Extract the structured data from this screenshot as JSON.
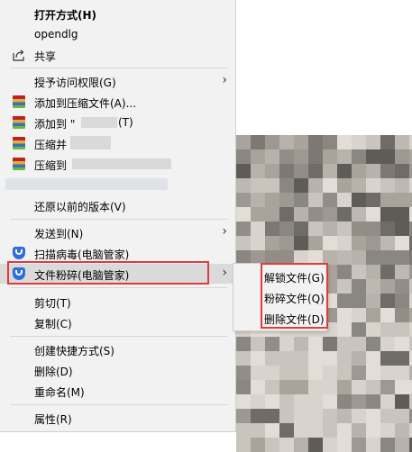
{
  "menu": {
    "open_with_bold": "打开方式(H)",
    "opendlg": "opendlg",
    "share": "共享",
    "grant_access": "授予访问权限(G)",
    "add_to_archive": "添加到压缩文件(A)...",
    "add_to_prefix": "添加到 \"",
    "add_to_suffix": "(T)",
    "compress_and": "压缩并",
    "compress_to": "压缩到",
    "restore_previous": "还原以前的版本(V)",
    "send_to": "发送到(N)",
    "scan_virus": "扫描病毒(电脑管家)",
    "shred_file": "文件粉碎(电脑管家)",
    "cut": "剪切(T)",
    "copy": "复制(C)",
    "create_shortcut": "创建快捷方式(S)",
    "delete": "删除(D)",
    "rename": "重命名(M)",
    "properties": "属性(R)"
  },
  "submenu": {
    "unlock": "解锁文件(G)",
    "shred": "粉碎文件(Q)",
    "delete": "删除文件(D)"
  },
  "colors": {
    "highlight_box": "#e23b3b",
    "shield_blue": "#2d6fd6"
  },
  "icons": {
    "share": "share-icon",
    "archive": "winrar-icon",
    "shield": "pc-manager-shield-icon",
    "submenu_arrow": "chevron-right-icon"
  }
}
